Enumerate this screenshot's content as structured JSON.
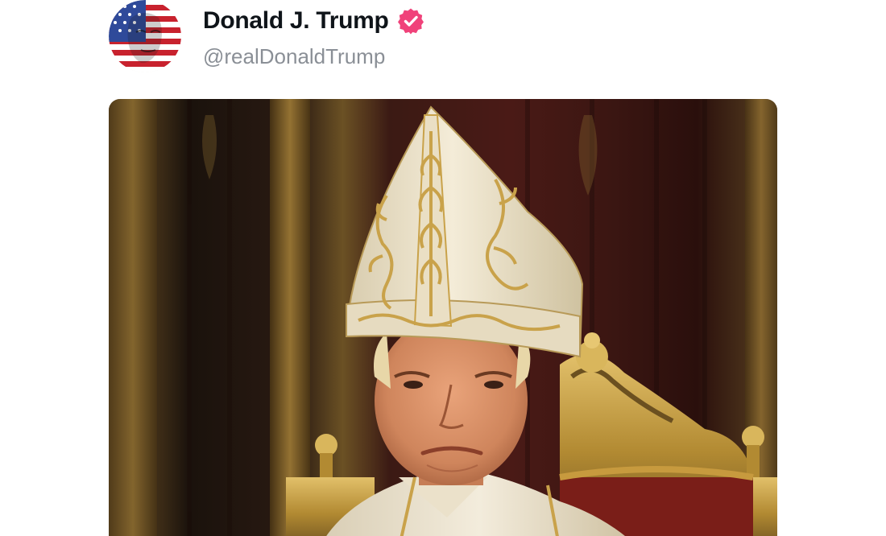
{
  "post": {
    "author": {
      "display_name": "Donald J. Trump",
      "handle": "@realDonaldTrump",
      "verified": true,
      "avatar_icon": "flag-portrait-avatar",
      "verified_icon": "verified-badge-icon"
    },
    "media": {
      "type": "image",
      "subject": "pope-portrait"
    }
  },
  "colors": {
    "name_text": "#0f1419",
    "handle_text": "#8a8f96",
    "verified_badge": "#f0427a",
    "mitre": "#efe6cf",
    "gold": "#c9a24a",
    "background_dark": "#2a1a12"
  }
}
